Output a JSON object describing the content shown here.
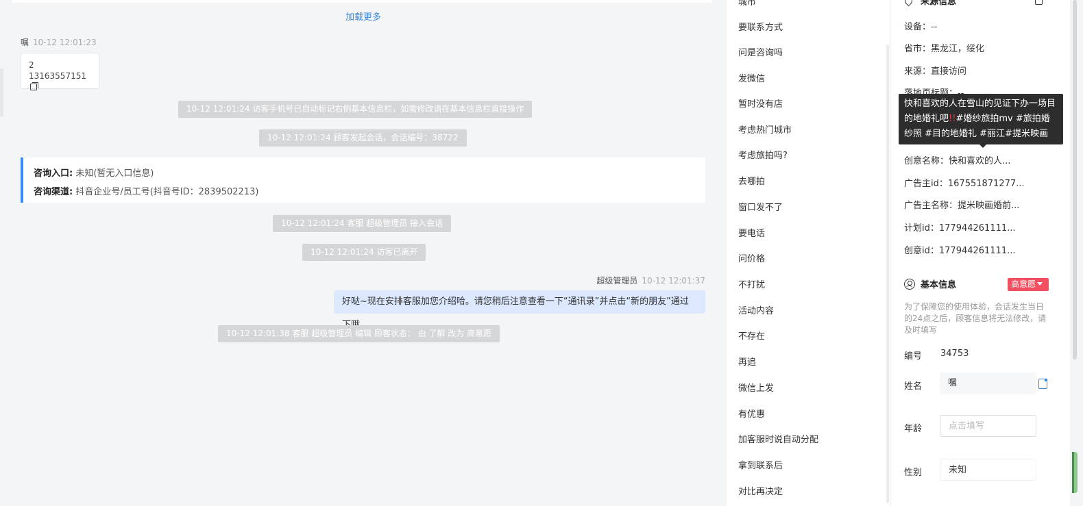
{
  "chat": {
    "load_more": "加载更多",
    "visitor": {
      "name": "嘱",
      "time": "10-12 12:01:23",
      "line1": "2",
      "line2": "13163557151"
    },
    "system_messages": [
      "10-12 12:01:24 访客手机号已自动标记右侧基本信息栏，如需修改请在基本信息栏直接操作",
      "10-12 12:01:24 顾客发起会话，会话编号：38722",
      "10-12 12:01:24 客服 超级管理员 接入会话",
      "10-12 12:01:24 访客已离开",
      "10-12 12:01:38 客服 超级管理员 编辑 顾客状态： 由 了解 改为 高意愿"
    ],
    "info_card": {
      "entry_label": "咨询入口:",
      "entry_value": "未知(暂无入口信息)",
      "channel_label": "咨询渠道:",
      "channel_value": "抖音企业号/员工号(抖音号ID：2839502213)"
    },
    "agent": {
      "name": "超级管理员",
      "time": "10-12 12:01:37",
      "message": "好哒~现在安排客服加您介绍哈。请您稍后注意查看一下“通讯录”并点击“新的朋友”通过下哦"
    }
  },
  "phrases": [
    "城市",
    "要联系方式",
    "问是咨询吗",
    "发微信",
    "暂时没有店",
    "考虑热门城市",
    "考虑旅拍吗?",
    "去哪拍",
    "窗口发不了",
    "要电话",
    "问价格",
    "不打扰",
    "活动内容",
    "不存在",
    "再追",
    "微信上发",
    "有优惠",
    "加客服时说自动分配",
    "拿到联系后",
    "对比再决定"
  ],
  "source": {
    "title": "来源信息",
    "device_label": "设备：",
    "device_value": "--",
    "province_label": "省市：",
    "province_value": "黑龙江，绥化",
    "origin_label": "来源：",
    "origin_value": "直接访问",
    "landing_label": "落地页标题：",
    "landing_value": "--",
    "creative_name_label": "创意名称：",
    "creative_name_value": "快和喜欢的人...",
    "advertiser_id_label": "广告主id：",
    "advertiser_id_value": "167551871277...",
    "advertiser_name_label": "广告主名称：",
    "advertiser_name_value": "提米映画婚前...",
    "plan_id_label": "计划id：",
    "plan_id_value": "177944261111...",
    "creative_id_label": "创意id：",
    "creative_id_value": "177944261111..."
  },
  "tooltip": {
    "text_a": "快和喜欢的人在雪山的见证下办一场目的地婚礼吧",
    "bang": "!!",
    "text_b": "#婚纱旅拍mv #旅拍婚纱照 #目的地婚礼 #丽江#提米映画"
  },
  "basic": {
    "title": "基本信息",
    "intent": "高意愿",
    "notice": "为了保障您的使用体验，会话发生当日的24点之后，顾客信息将无法修改，请及时填写",
    "number_label": "编号",
    "number_value": "34753",
    "name_label": "姓名",
    "name_value": "嘱",
    "age_label": "年龄",
    "age_placeholder": "点击填写",
    "gender_label": "性别",
    "gender_value": "未知"
  },
  "colors": {
    "accent_blue": "#3b8cf2",
    "intent_red": "#f25060",
    "agent_bubble": "#dbe8fd",
    "system_gray": "#d5d6d8"
  }
}
